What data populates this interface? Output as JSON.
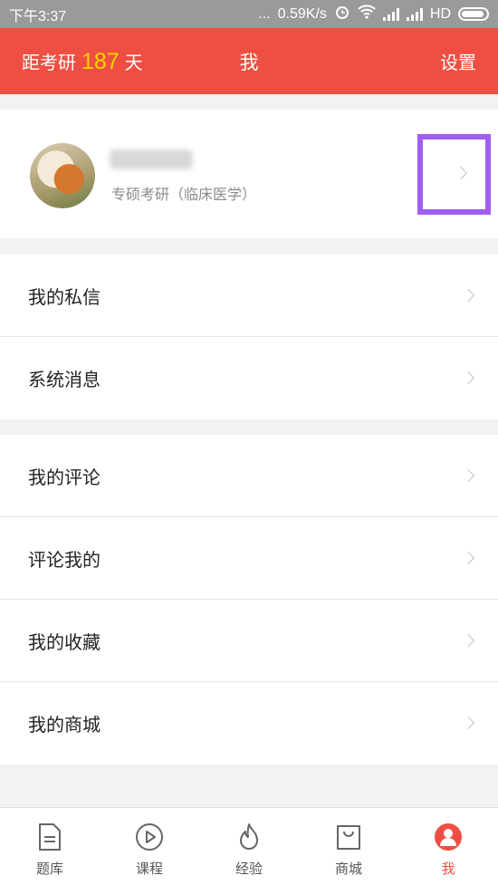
{
  "status_bar": {
    "time": "下午3:37",
    "dots": "...",
    "speed": "0.59K/s",
    "hd": "HD"
  },
  "header": {
    "countdown_prefix": "距考研",
    "countdown_days": "187",
    "countdown_suffix": "天",
    "title": "我",
    "settings": "设置"
  },
  "profile": {
    "username": "",
    "subtitle": "专硕考研（临床医学）"
  },
  "menu_group_1": [
    {
      "label": "我的私信"
    },
    {
      "label": "系统消息"
    }
  ],
  "menu_group_2": [
    {
      "label": "我的评论"
    },
    {
      "label": "评论我的"
    },
    {
      "label": "我的收藏"
    },
    {
      "label": "我的商城"
    }
  ],
  "tabs": [
    {
      "label": "题库",
      "icon": "document-icon"
    },
    {
      "label": "课程",
      "icon": "play-circle-icon"
    },
    {
      "label": "经验",
      "icon": "flame-icon"
    },
    {
      "label": "商城",
      "icon": "shopping-bag-icon"
    },
    {
      "label": "我",
      "icon": "person-icon",
      "active": true
    }
  ],
  "colors": {
    "accent": "#ef4f42",
    "countdown_number": "#ffd200",
    "highlight_box": "#a05ff0"
  }
}
